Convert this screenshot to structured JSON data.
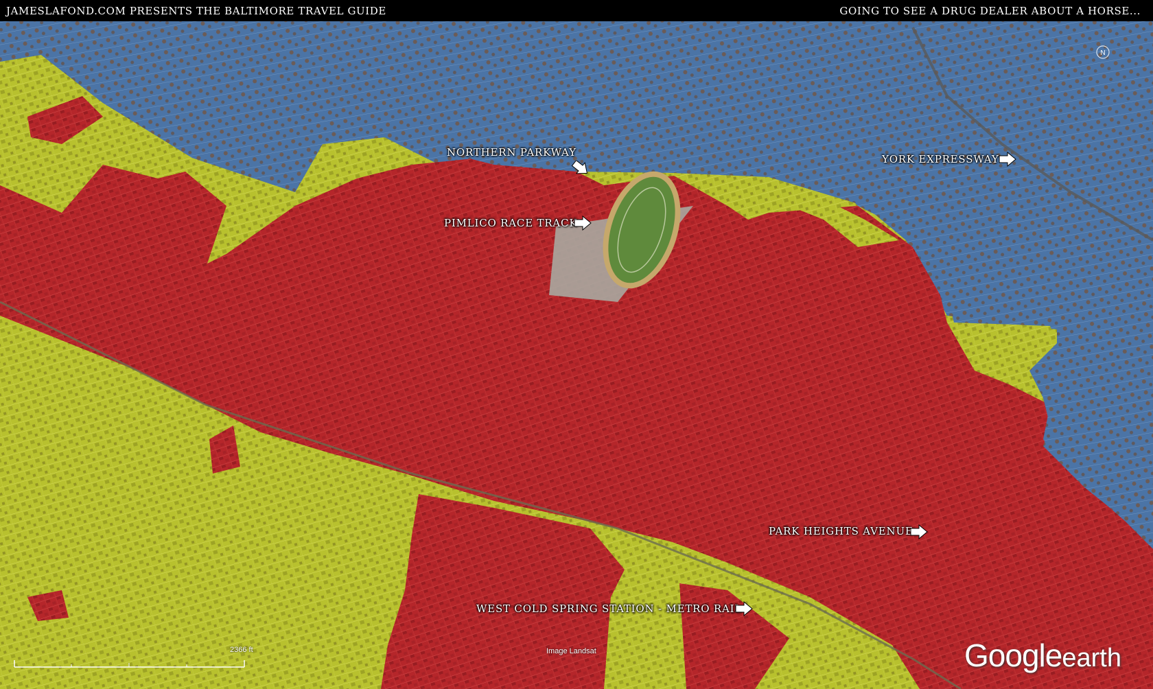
{
  "header": {
    "left_title": "JAMESLAFOND.COM PRESENTS THE BALTIMORE TRAVEL GUIDE",
    "right_title": "GOING TO SEE A DRUG DEALER ABOUT A HORSE..."
  },
  "labels": {
    "northern_parkway": "NORTHERN PARKWAY",
    "york_expressway": "YORK EXPRESSWAY",
    "pimlico_race_track": "PIMLICO RACE TRACK",
    "park_heights_avenue": "PARK HEIGHTS AVENUE",
    "west_cold_spring": "WEST COLD SPRING STATION - METRO RAIL"
  },
  "map_footer": {
    "scale": "2366 ft",
    "imagery": "Image Landsat",
    "brand_main": "Google",
    "brand_sub": "earth"
  },
  "zone_colors": {
    "red": "#b5262a",
    "yellow": "#b8c12e",
    "blue": "#4b74a6"
  }
}
